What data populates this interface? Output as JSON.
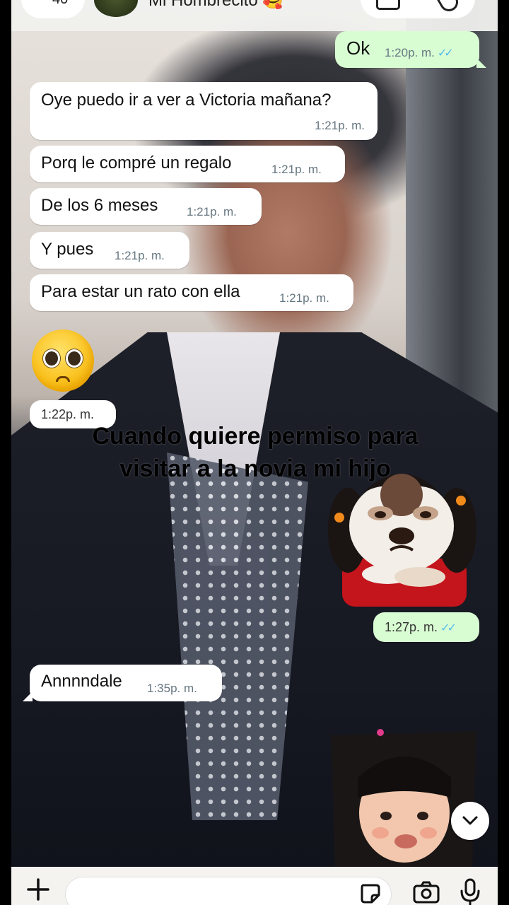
{
  "header": {
    "back_count": "40",
    "contact_name": "Mi Hombrecito 🥰"
  },
  "messages": [
    {
      "text": "Ok",
      "time": "1:20p. m."
    },
    {
      "text": "Oye puedo ir a ver a Victoria mañana?",
      "time": "1:21p. m."
    },
    {
      "text": "Porq le compré un regalo",
      "time": "1:21p. m."
    },
    {
      "text": "De los 6 meses",
      "time": "1:21p. m."
    },
    {
      "text": "Y pues",
      "time": "1:21p. m."
    },
    {
      "text": "Para estar un rato con ella",
      "time": "1:21p. m."
    },
    {
      "text": "",
      "time": "1:22p. m."
    },
    {
      "text": "",
      "time": "1:27p. m."
    },
    {
      "text": "Annnndale",
      "time": "1:35p. m."
    }
  ],
  "emoji": "pleading-face",
  "overlay_caption": "Cuando quiere permiso para visitar a la novia mi hijo",
  "stickers": [
    "chihuahua-wig-sticker",
    "pouting-girl-sticker"
  ],
  "composer": {
    "placeholder": ""
  },
  "colors": {
    "incoming_bubble": "#ffffff",
    "outgoing_bubble": "#d9fdd3",
    "time_text": "#667781",
    "read_ticks": "#53bdeb"
  }
}
